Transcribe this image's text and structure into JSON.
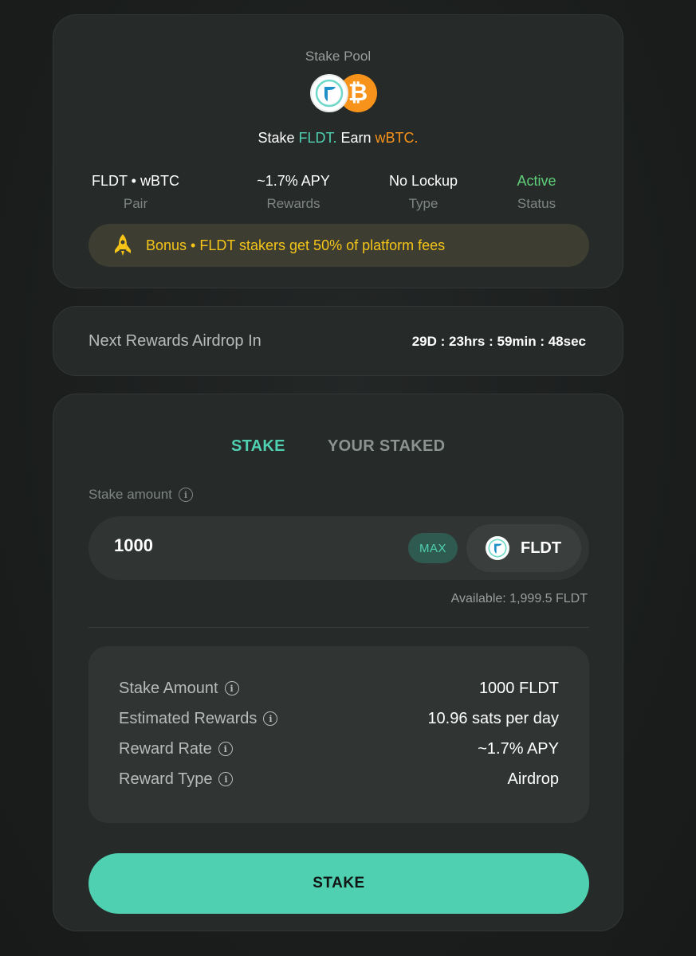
{
  "pool": {
    "title": "Stake Pool",
    "tagline_stake": "Stake ",
    "tagline_token": "FLDT.",
    "tagline_earn": " Earn ",
    "tagline_reward": "wBTC.",
    "stats": [
      {
        "value": "FLDT • wBTC",
        "label": "Pair"
      },
      {
        "value": "~1.7% APY",
        "label": "Rewards"
      },
      {
        "value": "No Lockup",
        "label": "Type"
      },
      {
        "value": "Active",
        "label": "Status"
      }
    ],
    "bonus": "Bonus • FLDT stakers get 50% of platform fees",
    "btc_symbol": "₿"
  },
  "airdrop": {
    "label": "Next Rewards Airdrop In",
    "countdown": "29D : 23hrs : 59min : 48sec"
  },
  "stake": {
    "tabs": [
      "STAKE",
      "YOUR STAKED"
    ],
    "amount_label": "Stake amount",
    "amount_value": "1000",
    "max_label": "MAX",
    "token": "FLDT",
    "available": "Available: 1,999.5 FLDT",
    "summary": [
      {
        "key": "Stake Amount",
        "value": "1000 FLDT"
      },
      {
        "key": "Estimated Rewards",
        "value": "10.96 sats per day"
      },
      {
        "key": "Reward Rate",
        "value": "~1.7% APY"
      },
      {
        "key": "Reward Type",
        "value": "Airdrop"
      }
    ],
    "button_label": "STAKE"
  },
  "colors": {
    "accent": "#4fd1b1",
    "btc_orange": "#f7931a",
    "bonus_yellow": "#f5c518",
    "active_green": "#5fcf7a"
  },
  "icons": [
    "fldt-logo-icon",
    "bitcoin-icon",
    "rocket-icon",
    "info-icon"
  ]
}
